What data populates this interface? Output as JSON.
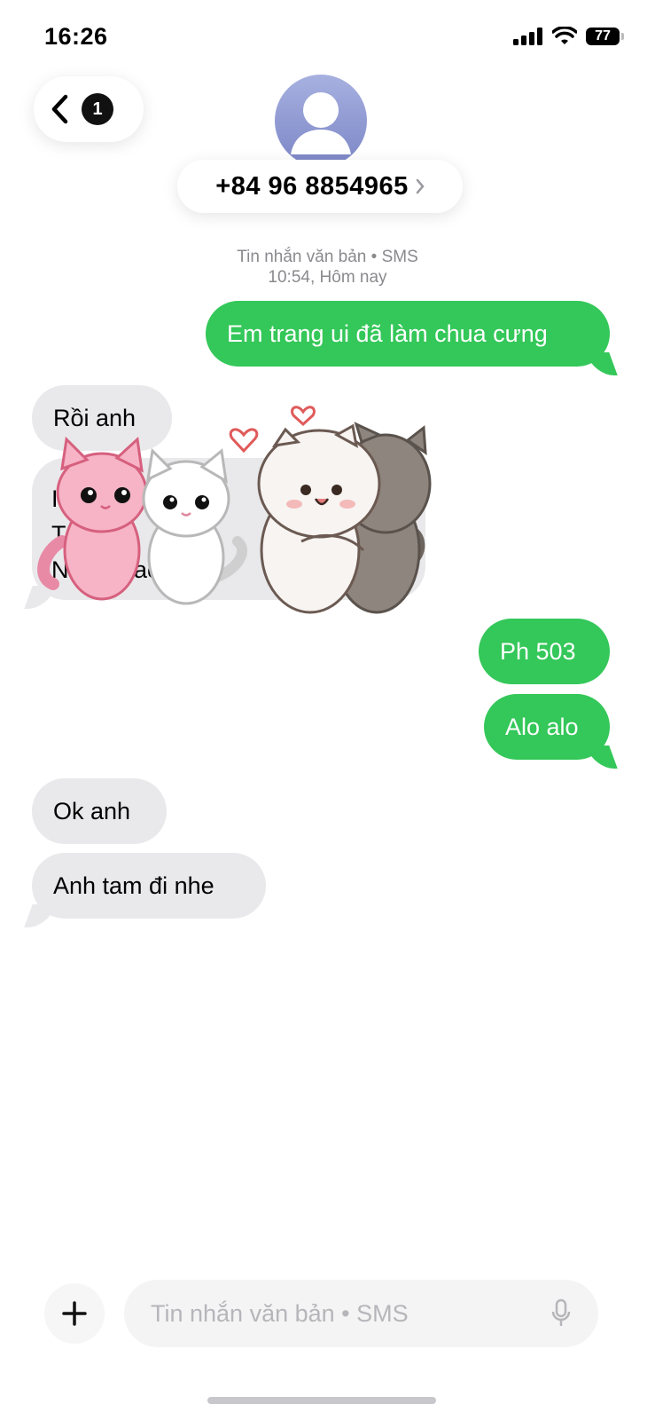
{
  "status_bar": {
    "time": "16:26",
    "battery": "77"
  },
  "header": {
    "back_badge": "1",
    "phone_number": "+84 96 8854965"
  },
  "conversation": {
    "service_label": "Tin nhắn văn bản • SMS",
    "timestamp": "10:54, Hôm nay"
  },
  "messages": [
    {
      "direction": "outgoing",
      "text": "Em trang ui đã làm chua cưng"
    },
    {
      "direction": "incoming",
      "text": "Rồi anh"
    },
    {
      "direction": "incoming",
      "lines": [
        "I…g",
        "T…,P2",
        "N…N…ac â"
      ]
    },
    {
      "direction": "outgoing",
      "text": "Ph 503"
    },
    {
      "direction": "outgoing",
      "text": "Alo alo"
    },
    {
      "direction": "incoming",
      "text": "Ok anh"
    },
    {
      "direction": "incoming",
      "text": "Anh tam đi nhe"
    }
  ],
  "composer": {
    "placeholder": "Tin nhắn văn bản • SMS"
  },
  "colors": {
    "outgoing_bubble": "#34c759",
    "incoming_bubble": "#e9e9eb",
    "meta_text": "#8a8a8e"
  },
  "icons": {
    "back": "chevron-left-icon",
    "avatar": "person-icon",
    "number_chevron": "chevron-right-icon",
    "add": "plus-icon",
    "mic": "microphone-icon"
  }
}
